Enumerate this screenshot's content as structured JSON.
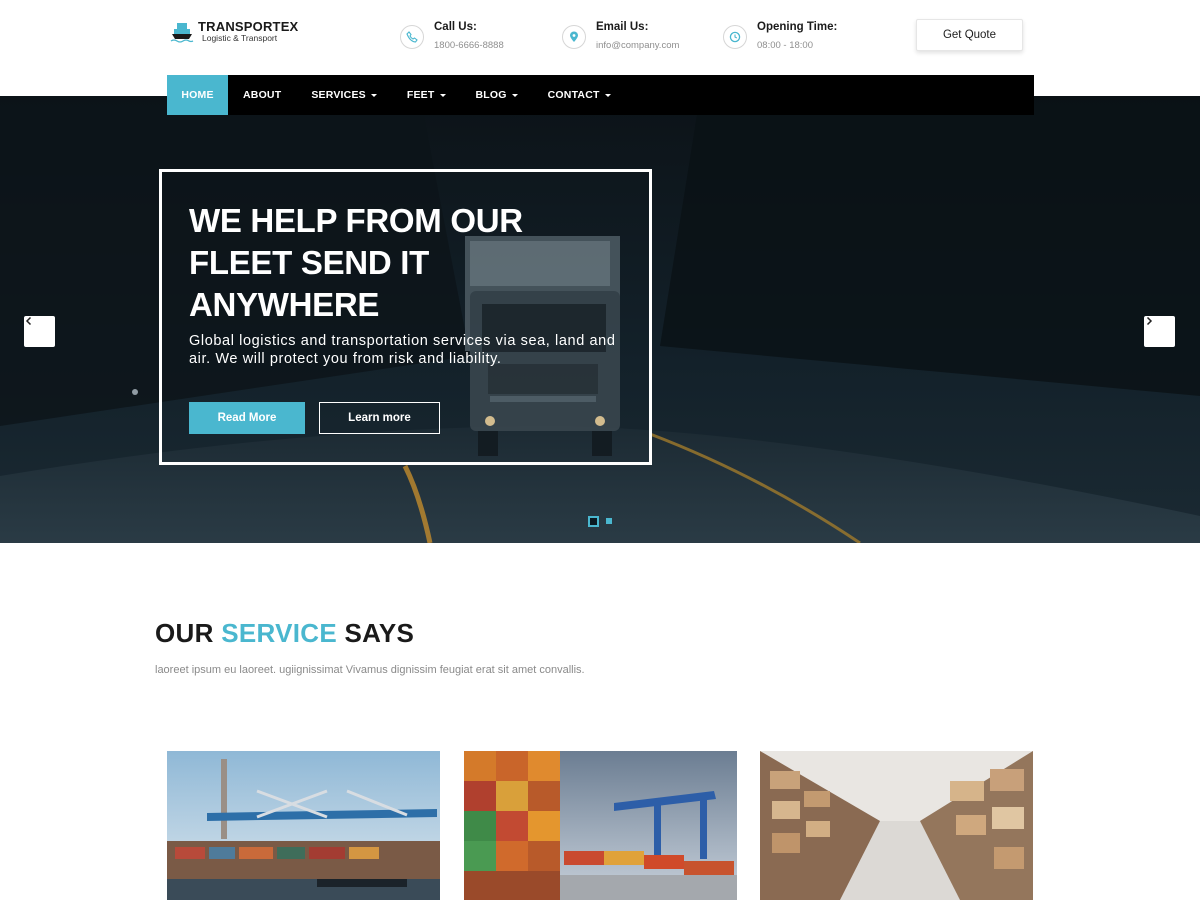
{
  "brand": {
    "name": "TRANSPORTEX",
    "tagline": "Logistic & Transport"
  },
  "contacts": [
    {
      "label": "Call Us:",
      "value": "1800-6666-8888",
      "icon": "phone-icon"
    },
    {
      "label": "Email Us:",
      "value": "info@company.com",
      "icon": "location-pin-icon"
    },
    {
      "label": "Opening Time:",
      "value": "08:00 - 18:00",
      "icon": "clock-icon"
    }
  ],
  "quote_button": "Get Quote",
  "nav": [
    {
      "label": "HOME",
      "active": true,
      "dropdown": false
    },
    {
      "label": "ABOUT",
      "active": false,
      "dropdown": false
    },
    {
      "label": "SERVICES",
      "active": false,
      "dropdown": true
    },
    {
      "label": "FEET",
      "active": false,
      "dropdown": true
    },
    {
      "label": "BLOG",
      "active": false,
      "dropdown": true
    },
    {
      "label": "CONTACT",
      "active": false,
      "dropdown": true
    }
  ],
  "hero": {
    "title_lines": [
      "WE HELP FROM OUR",
      "FLEET SEND IT",
      "ANYWHERE"
    ],
    "text": "Global logistics and transportation services via sea, land and air. We will protect you from risk and liability.",
    "primary_button": "Read More",
    "secondary_button": "Learn more",
    "slide_count": 2,
    "active_slide": 1
  },
  "services": {
    "title_pre": "OUR",
    "title_highlight": "SERVICE",
    "title_post": "SAYS",
    "subtitle": "laoreet ipsum eu laoreet. ugiignissimat Vivamus dignissim feugiat erat sit amet convallis."
  },
  "colors": {
    "accent": "#4ab7cf",
    "nav_bg": "#000000",
    "text_dark": "#1a1a1a",
    "muted": "#8a8a8a"
  }
}
